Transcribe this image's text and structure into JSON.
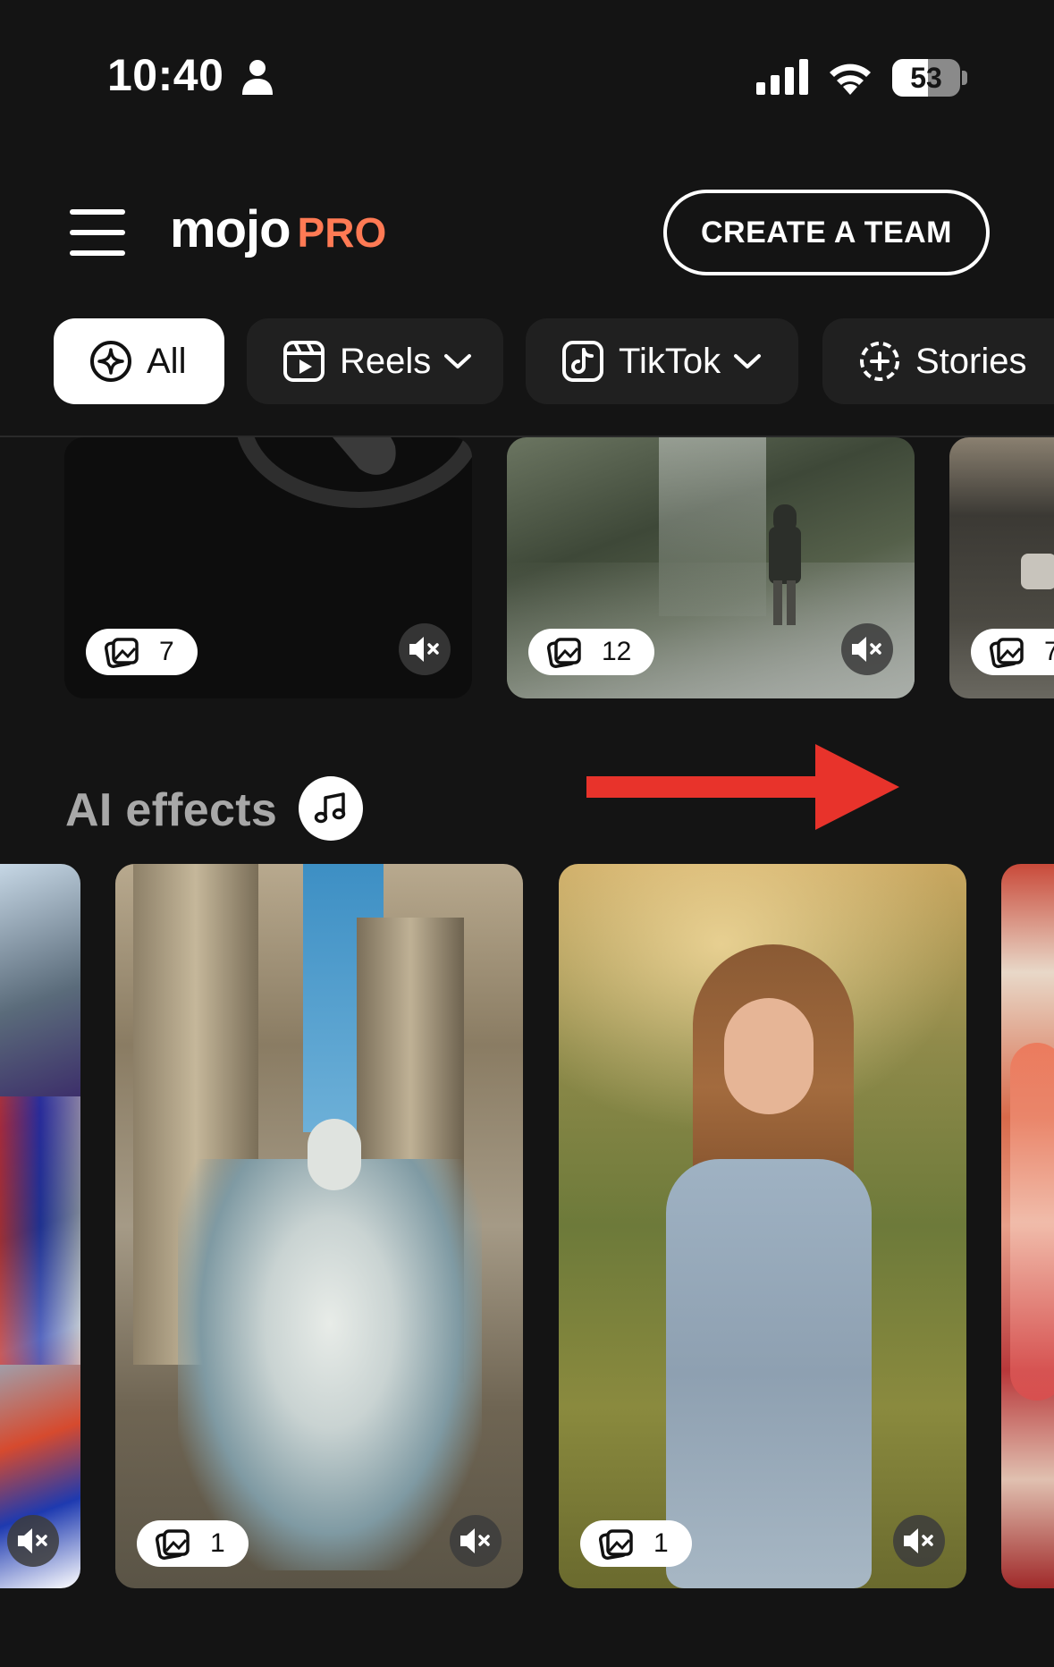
{
  "status_bar": {
    "time": "10:40",
    "battery_percent": "53",
    "battery_level": 0.53
  },
  "header": {
    "logo_main": "mojo",
    "logo_pro": "PRO",
    "create_team_label": "CREATE A TEAM"
  },
  "filters": [
    {
      "label": "All",
      "icon": "sparkle-circle-icon",
      "active": true,
      "dropdown": false
    },
    {
      "label": "Reels",
      "icon": "reels-icon",
      "active": false,
      "dropdown": true
    },
    {
      "label": "TikTok",
      "icon": "tiktok-icon",
      "active": false,
      "dropdown": true
    },
    {
      "label": "Stories",
      "icon": "stories-icon",
      "active": false,
      "dropdown": false
    }
  ],
  "top_row": [
    {
      "count": "7",
      "muted": true
    },
    {
      "count": "12",
      "muted": true
    },
    {
      "count": "7",
      "muted": false
    }
  ],
  "ai_section": {
    "title": "AI effects",
    "music_icon": "music-note-icon",
    "cards": [
      {
        "count": "",
        "muted": true
      },
      {
        "count": "1",
        "muted": true
      },
      {
        "count": "1",
        "muted": true
      },
      {
        "count": "",
        "muted": false
      }
    ]
  },
  "annotation": {
    "arrow_color": "#e8332b",
    "direction": "right"
  },
  "colors": {
    "background": "#141414",
    "accent": "#ff7a54",
    "chip_bg": "#202020"
  }
}
